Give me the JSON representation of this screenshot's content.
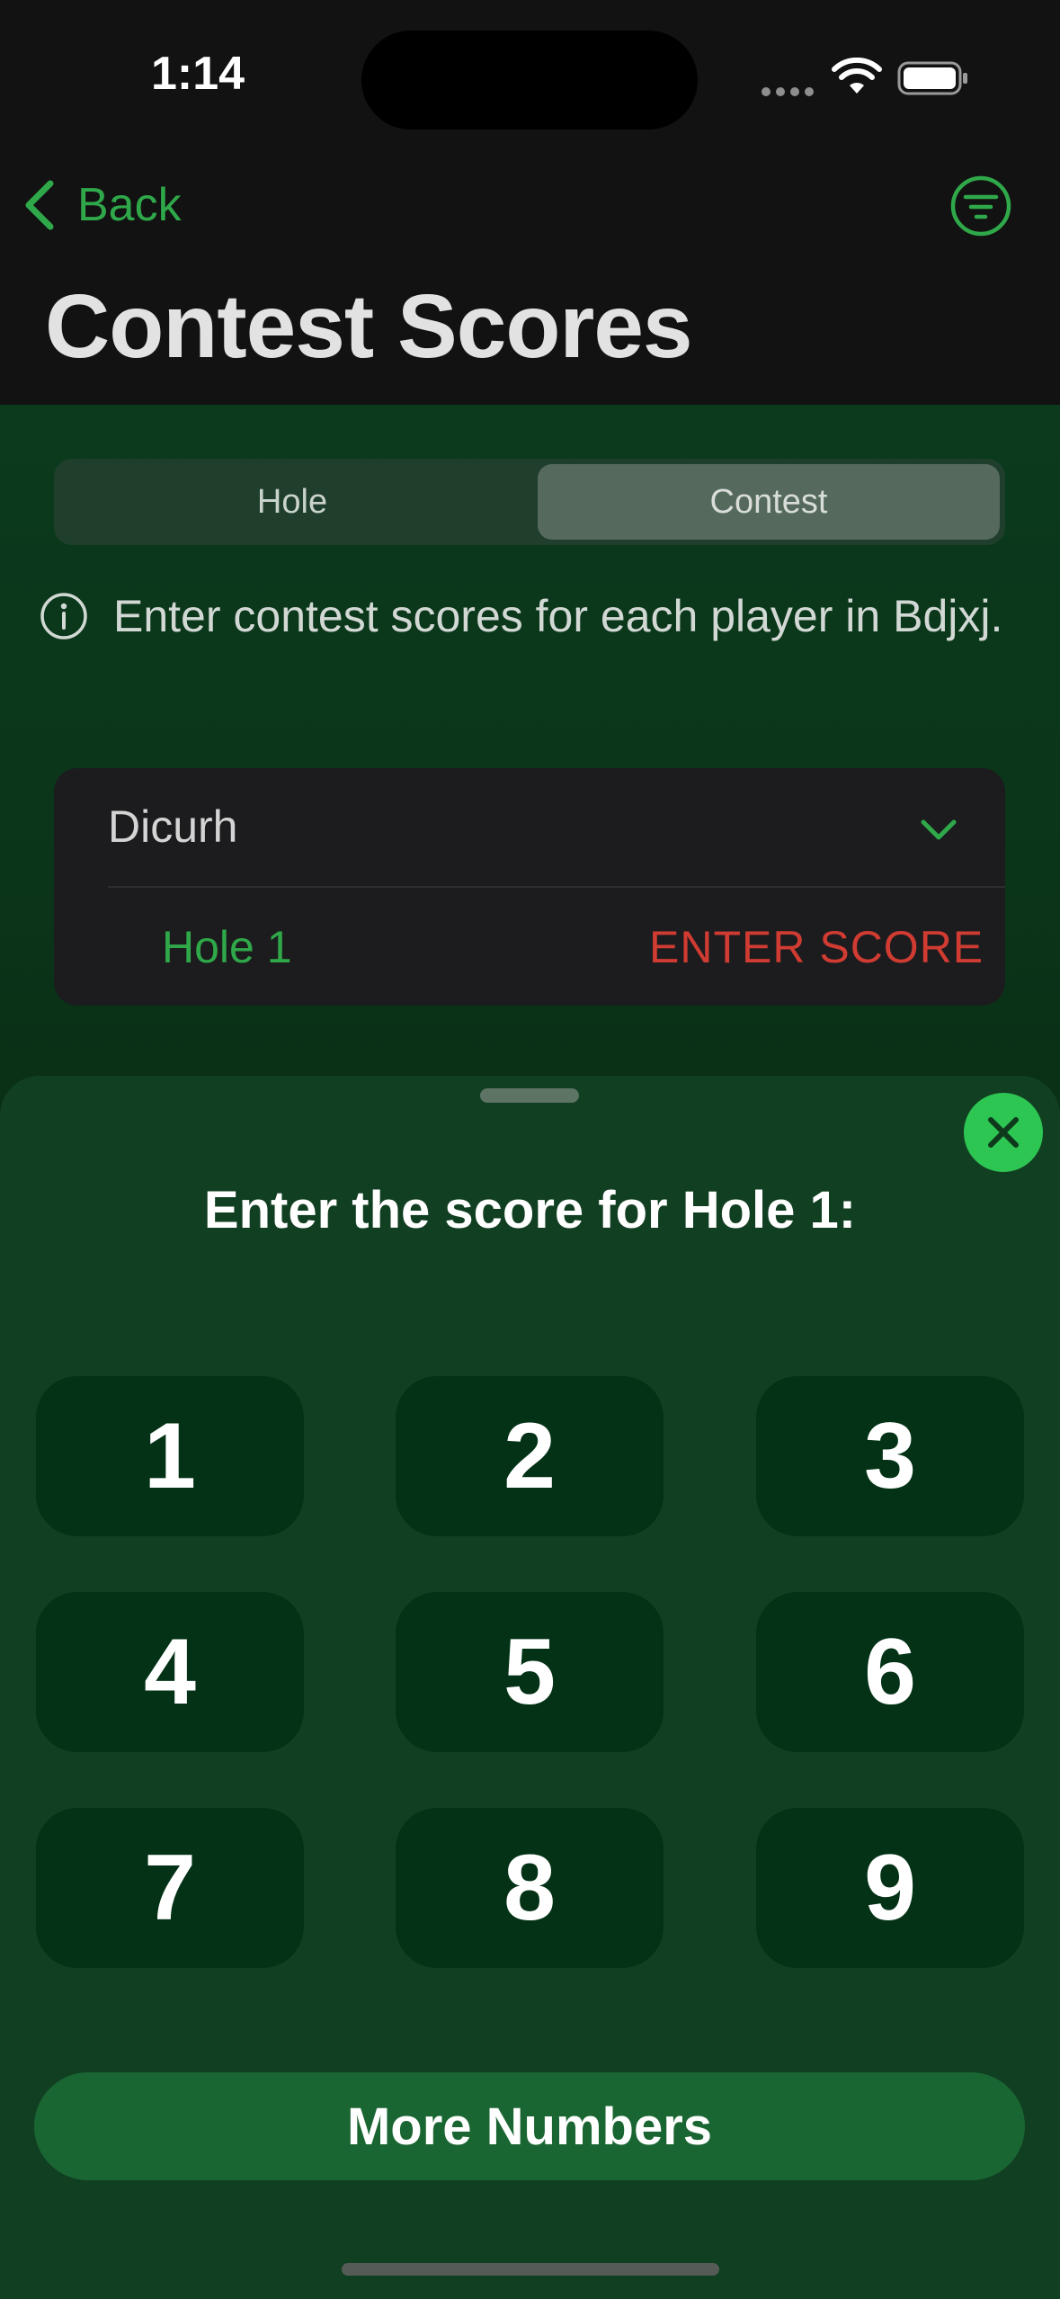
{
  "status_bar": {
    "time": "1:14"
  },
  "nav": {
    "back_label": "Back",
    "title": "Contest Scores"
  },
  "segmented": {
    "hole": "Hole",
    "contest": "Contest",
    "selected": "Contest"
  },
  "info": {
    "text": "Enter contest scores for each player in Bdjxj."
  },
  "player_card": {
    "name": "Dicurh",
    "hole": "Hole 1",
    "action": "ENTER SCORE"
  },
  "sheet": {
    "title": "Enter the score for Hole 1:",
    "keys": [
      "1",
      "2",
      "3",
      "4",
      "5",
      "6",
      "7",
      "8",
      "9"
    ],
    "more_label": "More Numbers"
  },
  "colors": {
    "accent_green": "#2fa84a",
    "alert_red": "#d03b32",
    "close_green": "#2ec653"
  }
}
